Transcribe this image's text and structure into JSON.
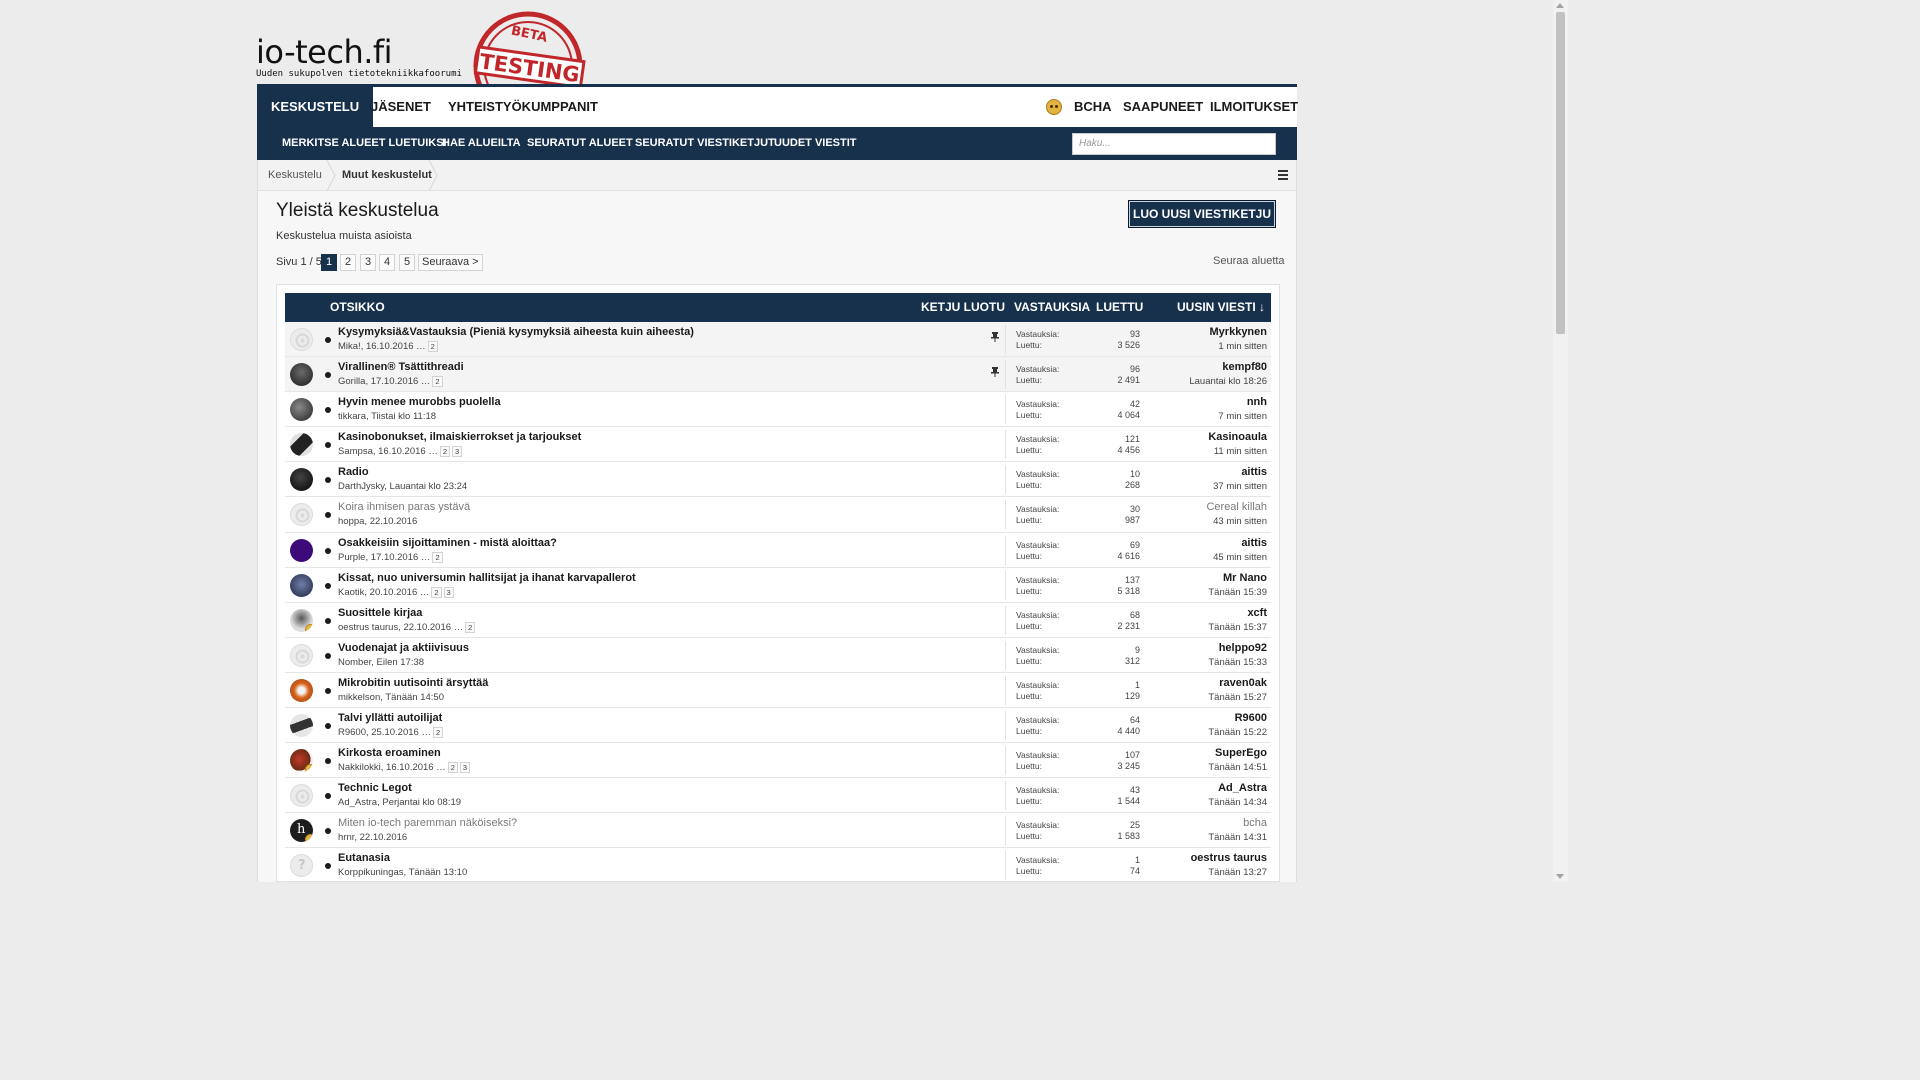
{
  "site": {
    "name": "io-tech.fi",
    "tagline": "Uuden sukupolven tietotekniikkafoorumi",
    "stamp_top": "BETA",
    "stamp_main": "TESTING"
  },
  "nav": {
    "tabs": [
      "KESKUSTELU",
      "JÄSENET",
      "YHTEISTYÖKUMPPANIT"
    ],
    "right": [
      "BCHA",
      "SAAPUNEET",
      "ILMOITUKSET"
    ]
  },
  "subnav": {
    "items": [
      "MERKITSE ALUEET LUETUIKSI",
      "HAE ALUEILTA",
      "SEURATUT ALUEET",
      "SEURATUT VIESTIKETJUT",
      "UUDET VIESTIT"
    ],
    "search_placeholder": "Haku..."
  },
  "breadcrumb": [
    "Keskustelu",
    "Muut keskustelut"
  ],
  "page": {
    "title": "Yleistä keskustelua",
    "description": "Keskustelua muista asioista",
    "new_thread_label": "LUO UUSI VIESTIKETJU",
    "follow_label": "Seuraa aluetta"
  },
  "pager": {
    "label": "Sivu 1 / 5",
    "pages": [
      "1",
      "2",
      "3",
      "4",
      "5"
    ],
    "current": "1",
    "next": "Seuraava >"
  },
  "table": {
    "headers": {
      "title": "OTSIKKO",
      "started": "KETJU LUOTU",
      "replies": "VASTAUKSIA",
      "views": "LUETTU",
      "latest": "UUSIN VIESTI ↓"
    },
    "replies_label": "Vastauksia:",
    "views_label": "Luettu:",
    "threads": [
      {
        "title": "Kysymyksiä&Vastauksia (Pieniä kysymyksiä aiheesta kuin aiheesta)",
        "meta": "Mika!, 16.10.2016",
        "pages": [
          "2"
        ],
        "replies": "93",
        "views": "3 526",
        "last_user": "Myrkkynen",
        "last_time": "1 min sitten",
        "sticky": true,
        "read": false,
        "avatar": "default"
      },
      {
        "title": "Virallinen® Tsättithreadi",
        "meta": "Gorilla, 17.10.2016",
        "pages": [
          "2"
        ],
        "replies": "96",
        "views": "2 491",
        "last_user": "kempf80",
        "last_time": "Lauantai klo 18:26",
        "sticky": true,
        "read": false,
        "avatar": "gorilla"
      },
      {
        "title": "Hyvin menee murobbs puolella",
        "meta": "tikkara, Tiistai klo 11:18",
        "pages": [],
        "replies": "42",
        "views": "4 064",
        "last_user": "nnh",
        "last_time": "7 min sitten",
        "sticky": false,
        "read": false,
        "avatar": "dark-photo"
      },
      {
        "title": "Kasinobonukset, ilmaiskierrokset ja tarjoukset",
        "meta": "Sampsa, 16.10.2016",
        "pages": [
          "2",
          "3"
        ],
        "replies": "121",
        "views": "4 456",
        "last_user": "Kasinoaula",
        "last_time": "11 min sitten",
        "sticky": false,
        "read": false,
        "avatar": "gpu"
      },
      {
        "title": "Radio",
        "meta": "DarthJysky, Lauantai klo 23:24",
        "pages": [],
        "replies": "10",
        "views": "268",
        "last_user": "aittis",
        "last_time": "37 min sitten",
        "sticky": false,
        "read": false,
        "avatar": "black"
      },
      {
        "title": "Koira ihmisen paras ystävä",
        "meta": "hoppa, 22.10.2016",
        "pages": [],
        "replies": "30",
        "views": "987",
        "last_user": "Cereal killah",
        "last_time": "43 min sitten",
        "sticky": false,
        "read": true,
        "avatar": "default"
      },
      {
        "title": "Osakkeisiin sijoittaminen - mistä aloittaa?",
        "meta": "Purple, 17.10.2016",
        "pages": [
          "2"
        ],
        "replies": "69",
        "views": "4 616",
        "last_user": "aittis",
        "last_time": "45 min sitten",
        "sticky": false,
        "read": false,
        "avatar": "purple"
      },
      {
        "title": "Kissat, nuo universumin hallitsijat ja ihanat karvapallerot",
        "meta": "Kaotik, 20.10.2016",
        "pages": [
          "2",
          "3"
        ],
        "replies": "137",
        "views": "5 318",
        "last_user": "Mr Nano",
        "last_time": "Tänään 15:39",
        "sticky": false,
        "read": false,
        "avatar": "blue-photo"
      },
      {
        "title": "Suosittele kirjaa",
        "meta": "oestrus taurus, 22.10.2016",
        "pages": [
          "2"
        ],
        "replies": "68",
        "views": "2 231",
        "last_user": "xcft",
        "last_time": "Tänään 15:37",
        "sticky": false,
        "read": false,
        "avatar": "figure"
      },
      {
        "title": "Vuodenajat ja aktiivisuus",
        "meta": "Nomber, Eilen 17:38",
        "pages": [],
        "replies": "9",
        "views": "312",
        "last_user": "helppo92",
        "last_time": "Tänään 15:33",
        "sticky": false,
        "read": false,
        "avatar": "default"
      },
      {
        "title": "Mikrobitin uutisointi ärsyttää",
        "meta": "mikkelson, Tänään 14:50",
        "pages": [],
        "replies": "1",
        "views": "129",
        "last_user": "raven0ak",
        "last_time": "Tänään 15:27",
        "sticky": false,
        "read": false,
        "avatar": "fox"
      },
      {
        "title": "Talvi yllätti autoilijat",
        "meta": "R9600, 25.10.2016",
        "pages": [
          "2"
        ],
        "replies": "64",
        "views": "4 440",
        "last_user": "R9600",
        "last_time": "Tänään 15:22",
        "sticky": false,
        "read": false,
        "avatar": "gpu2"
      },
      {
        "title": "Kirkosta eroaminen",
        "meta": "Nakkilokki, 16.10.2016",
        "pages": [
          "2",
          "3"
        ],
        "replies": "107",
        "views": "3 245",
        "last_user": "SuperEgo",
        "last_time": "Tänään 14:51",
        "sticky": false,
        "read": false,
        "avatar": "cartoon"
      },
      {
        "title": "Technic Legot",
        "meta": "Ad_Astra, Perjantai klo 08:19",
        "pages": [],
        "replies": "43",
        "views": "1 544",
        "last_user": "Ad_Astra",
        "last_time": "Tänään 14:34",
        "sticky": false,
        "read": false,
        "avatar": "default"
      },
      {
        "title": "Miten io-tech paremman näköiseksi?",
        "meta": "hrnr, 22.10.2016",
        "pages": [],
        "replies": "25",
        "views": "1 583",
        "last_user": "bcha",
        "last_time": "Tänään 14:31",
        "sticky": false,
        "read": true,
        "avatar": "letter-h"
      },
      {
        "title": "Eutanasia",
        "meta": "Korppikuningas, Tänään 13:10",
        "pages": [],
        "replies": "1",
        "views": "74",
        "last_user": "oestrus taurus",
        "last_time": "Tänään 13:27",
        "sticky": false,
        "read": false,
        "avatar": "question"
      }
    ]
  },
  "colors": {
    "navy": "#17304c",
    "page_bg": "#ececec",
    "stamp_red": "#c0262a"
  }
}
